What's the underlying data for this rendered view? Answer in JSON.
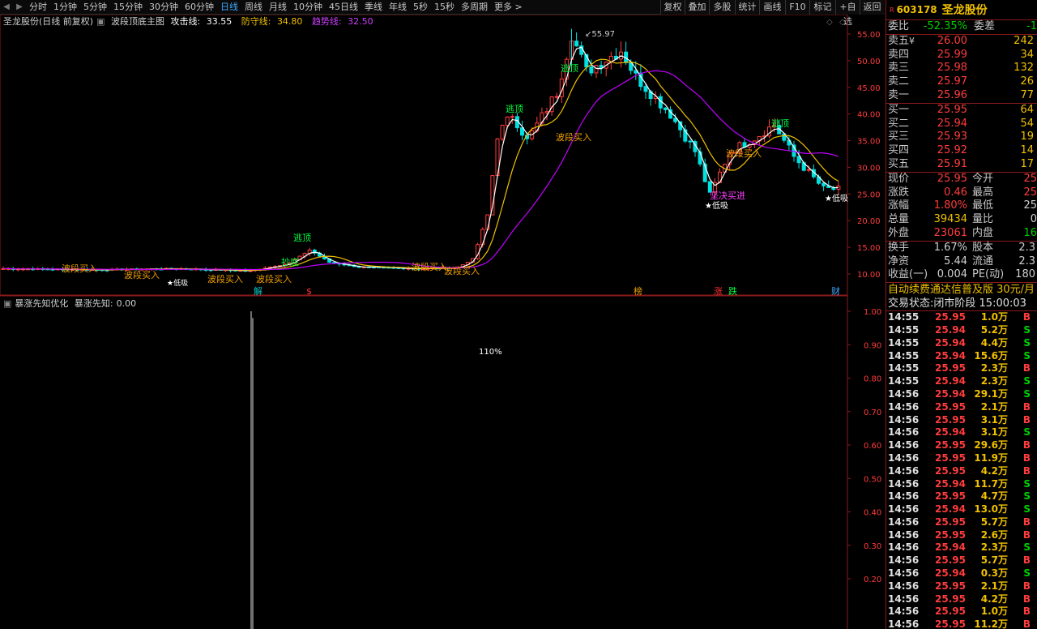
{
  "toolbar": {
    "periods": [
      "分时",
      "1分钟",
      "5分钟",
      "15分钟",
      "30分钟",
      "60分钟",
      "日线",
      "周线",
      "月线",
      "10分钟",
      "45日线",
      "季线",
      "年线",
      "5秒",
      "15秒",
      "多周期",
      "更多 >"
    ],
    "active_period": "日线",
    "right_buttons": [
      "复权",
      "叠加",
      "多股",
      "统计",
      "画线",
      "F10",
      "标记",
      "+自选",
      "返回"
    ]
  },
  "main_legend": {
    "stock_label": "圣龙股份(日线 前复权)",
    "indicator_name": "波段顶底主图",
    "attack_label": "攻击线:",
    "attack_value": "33.55",
    "defense_label": "防守线:",
    "defense_value": "34.80",
    "trend_label": "趋势线:",
    "trend_value": "32.50"
  },
  "sub_legend": {
    "indicator_name": "暴涨先知优化",
    "item_label": "暴涨先知:",
    "item_value": "0.00"
  },
  "chart_labels": {
    "peak_price": "55.97",
    "percent_label": "110%",
    "signal_top": "逃顶",
    "signal_buy": "波段买入",
    "signal_low": "低吸",
    "signal_firm": "坚决买进",
    "signal_breakout": "抄底",
    "events": [
      "解",
      "$",
      "榜",
      "涨",
      "跌",
      "财"
    ]
  },
  "colors": {
    "up": "#ff3c3c",
    "down": "#00e0e0",
    "attack": "#ffffff",
    "defense": "#f0c000",
    "trend": "#c000ff",
    "grid_border": "#8a1a1a"
  },
  "chart_data": [
    {
      "type": "candlestick",
      "title": "波段顶底主图",
      "ylim": [
        8.0,
        57.0
      ],
      "yticks": [
        10,
        15,
        20,
        25,
        30,
        35,
        40,
        45,
        50,
        55
      ],
      "ytick_labels": [
        "10.00",
        "15.00",
        "20.00",
        "25.00",
        "30.00",
        "35.00",
        "40.00",
        "45.00",
        "50.00",
        "55.00"
      ],
      "series": [
        {
          "name": "攻击线",
          "last": 33.55
        },
        {
          "name": "防守线",
          "last": 34.8
        },
        {
          "name": "趋势线",
          "last": 32.5
        }
      ],
      "max_high": 55.97
    },
    {
      "type": "bar",
      "title": "暴涨先知优化",
      "ylim": [
        0,
        1.05
      ],
      "yticks": [
        0.2,
        0.3,
        0.4,
        0.5,
        0.6,
        0.7,
        0.8,
        0.9,
        1.0
      ],
      "ytick_labels": [
        "0.20",
        "0.30",
        "0.40",
        "0.50",
        "0.60",
        "0.70",
        "0.80",
        "0.90",
        "1.00"
      ],
      "spike_value": 1.0
    }
  ],
  "quote": {
    "code": "603178",
    "name": "圣龙股份",
    "badge": "R",
    "weibi_label": "委比",
    "weibi_value": "-52.35%",
    "weicha_label": "委差",
    "weicha_value": "-1",
    "asks": [
      {
        "label": "卖五",
        "flag": "¥",
        "price": "26.00",
        "vol": "242"
      },
      {
        "label": "卖四",
        "flag": "",
        "price": "25.99",
        "vol": "34"
      },
      {
        "label": "卖三",
        "flag": "",
        "price": "25.98",
        "vol": "132"
      },
      {
        "label": "卖二",
        "flag": "",
        "price": "25.97",
        "vol": "26"
      },
      {
        "label": "卖一",
        "flag": "",
        "price": "25.96",
        "vol": "77"
      }
    ],
    "bids": [
      {
        "label": "买一",
        "price": "25.95",
        "vol": "64"
      },
      {
        "label": "买二",
        "price": "25.94",
        "vol": "54"
      },
      {
        "label": "买三",
        "price": "25.93",
        "vol": "19"
      },
      {
        "label": "买四",
        "price": "25.92",
        "vol": "14"
      },
      {
        "label": "买五",
        "price": "25.91",
        "vol": "17"
      }
    ],
    "stats": [
      {
        "l1": "现价",
        "v1": "25.95",
        "c1": "red",
        "l2": "今开",
        "v2": "25",
        "c2": "red"
      },
      {
        "l1": "涨跌",
        "v1": "0.46",
        "c1": "red",
        "l2": "最高",
        "v2": "25",
        "c2": "red"
      },
      {
        "l1": "涨幅",
        "v1": "1.80%",
        "c1": "red",
        "l2": "最低",
        "v2": "25",
        "c2": "white"
      },
      {
        "l1": "总量",
        "v1": "39434",
        "c1": "yellow",
        "l2": "量比",
        "v2": "0",
        "c2": "white"
      },
      {
        "l1": "外盘",
        "v1": "23061",
        "c1": "red",
        "l2": "内盘",
        "v2": "16",
        "c2": "green"
      }
    ],
    "stats2": [
      {
        "l1": "换手",
        "v1": "1.67%",
        "l2": "股本",
        "v2": "2.3"
      },
      {
        "l1": "净资",
        "v1": "5.44",
        "l2": "流通",
        "v2": "2.3"
      },
      {
        "l1": "收益(一)",
        "v1": "0.004",
        "l2": "PE(动)",
        "v2": "180"
      }
    ],
    "ad": "自动续费通达信普及版 30元/月",
    "status_label": "交易状态:",
    "status_value": "闭市阶段 15:00:03"
  },
  "ticks": [
    {
      "t": "14:55",
      "p": "25.95",
      "v": "1.0万",
      "bs": "B"
    },
    {
      "t": "14:55",
      "p": "25.94",
      "v": "5.2万",
      "bs": "S"
    },
    {
      "t": "14:55",
      "p": "25.94",
      "v": "4.4万",
      "bs": "S"
    },
    {
      "t": "14:55",
      "p": "25.94",
      "v": "15.6万",
      "bs": "S"
    },
    {
      "t": "14:55",
      "p": "25.95",
      "v": "2.3万",
      "bs": "B"
    },
    {
      "t": "14:55",
      "p": "25.94",
      "v": "2.3万",
      "bs": "S"
    },
    {
      "t": "14:56",
      "p": "25.94",
      "v": "29.1万",
      "bs": "S"
    },
    {
      "t": "14:56",
      "p": "25.95",
      "v": "2.1万",
      "bs": "B"
    },
    {
      "t": "14:56",
      "p": "25.95",
      "v": "3.1万",
      "bs": "B"
    },
    {
      "t": "14:56",
      "p": "25.94",
      "v": "3.1万",
      "bs": "S"
    },
    {
      "t": "14:56",
      "p": "25.95",
      "v": "29.6万",
      "bs": "B"
    },
    {
      "t": "14:56",
      "p": "25.95",
      "v": "11.9万",
      "bs": "B"
    },
    {
      "t": "14:56",
      "p": "25.95",
      "v": "4.2万",
      "bs": "B"
    },
    {
      "t": "14:56",
      "p": "25.94",
      "v": "11.7万",
      "bs": "S"
    },
    {
      "t": "14:56",
      "p": "25.95",
      "v": "4.7万",
      "bs": "S"
    },
    {
      "t": "14:56",
      "p": "25.94",
      "v": "13.0万",
      "bs": "S"
    },
    {
      "t": "14:56",
      "p": "25.95",
      "v": "5.7万",
      "bs": "B"
    },
    {
      "t": "14:56",
      "p": "25.95",
      "v": "2.6万",
      "bs": "B"
    },
    {
      "t": "14:56",
      "p": "25.94",
      "v": "2.3万",
      "bs": "S"
    },
    {
      "t": "14:56",
      "p": "25.95",
      "v": "5.7万",
      "bs": "B"
    },
    {
      "t": "14:56",
      "p": "25.94",
      "v": "0.3万",
      "bs": "S"
    },
    {
      "t": "14:56",
      "p": "25.95",
      "v": "2.1万",
      "bs": "B"
    },
    {
      "t": "14:56",
      "p": "25.95",
      "v": "4.2万",
      "bs": "B"
    },
    {
      "t": "14:56",
      "p": "25.95",
      "v": "1.0万",
      "bs": "B"
    },
    {
      "t": "14:56",
      "p": "25.95",
      "v": "11.2万",
      "bs": "B"
    }
  ]
}
